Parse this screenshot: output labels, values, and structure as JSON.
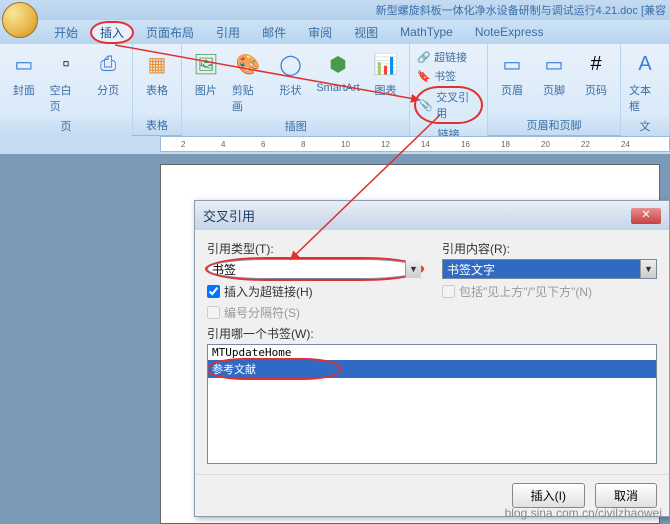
{
  "title_bar": {
    "doc_title": "新型螺旋斜板一体化净水设备研制与调试运行4.21.doc [兼容"
  },
  "tabs": {
    "t0": "开始",
    "t1": "插入",
    "t2": "页面布局",
    "t3": "引用",
    "t4": "邮件",
    "t5": "审阅",
    "t6": "视图",
    "t7": "MathType",
    "t8": "NoteExpress"
  },
  "ribbon": {
    "pages": {
      "label": "页",
      "cover": "封面",
      "blank": "空白页",
      "break": "分页"
    },
    "tables": {
      "label": "表格",
      "table": "表格"
    },
    "illust": {
      "label": "插图",
      "pic": "图片",
      "clip": "剪贴画",
      "shape": "形状",
      "smart": "SmartArt",
      "chart": "图表"
    },
    "links": {
      "label": "链接",
      "hyper": "超链接",
      "bookmark": "书签",
      "cross": "交叉引用"
    },
    "hf": {
      "label": "页眉和页脚",
      "header": "页眉",
      "footer": "页脚",
      "pagenum": "页码"
    },
    "text": {
      "label": "文",
      "textbox": "文本框"
    }
  },
  "dialog": {
    "title": "交叉引用",
    "ref_type_label": "引用类型(T):",
    "ref_type_value": "书签",
    "ref_content_label": "引用内容(R):",
    "ref_content_value": "书签文字",
    "chk_hyper": "插入为超链接(H)",
    "chk_above": "包括\"见上方\"/\"见下方\"(N)",
    "chk_num": "编号分隔符(S)",
    "which_label": "引用哪一个书签(W):",
    "item1": "MTUpdateHome",
    "item2": "参考文献",
    "btn_insert": "插入(I)",
    "btn_cancel": "取消"
  },
  "watermark": "blog.sina.com.cn/civilzhaowei"
}
